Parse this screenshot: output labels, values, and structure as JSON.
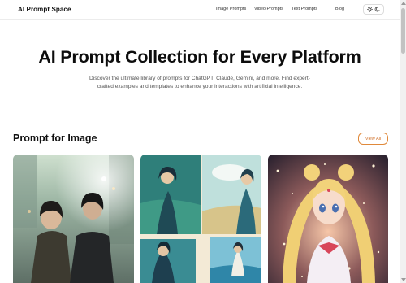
{
  "header": {
    "brand": "AI Prompt Space",
    "nav": [
      {
        "label": "Image Prompts"
      },
      {
        "label": "Video Prompts"
      },
      {
        "label": "Text Prompts"
      },
      {
        "label": "Blog"
      }
    ],
    "theme_icons": [
      "sun-icon",
      "moon-icon"
    ]
  },
  "hero": {
    "title": "AI Prompt Collection for Every Platform",
    "subtitle": "Discover the ultimate library of prompts for ChatGPT, Claude, Gemini, and more. Find expert-crafted examples and templates to enhance your interactions with artificial intelligence."
  },
  "section": {
    "title": "Prompt for Image",
    "view_all_label": "View All"
  },
  "colors": {
    "accent": "#e0893a",
    "text": "#111111",
    "muted": "#555555"
  }
}
